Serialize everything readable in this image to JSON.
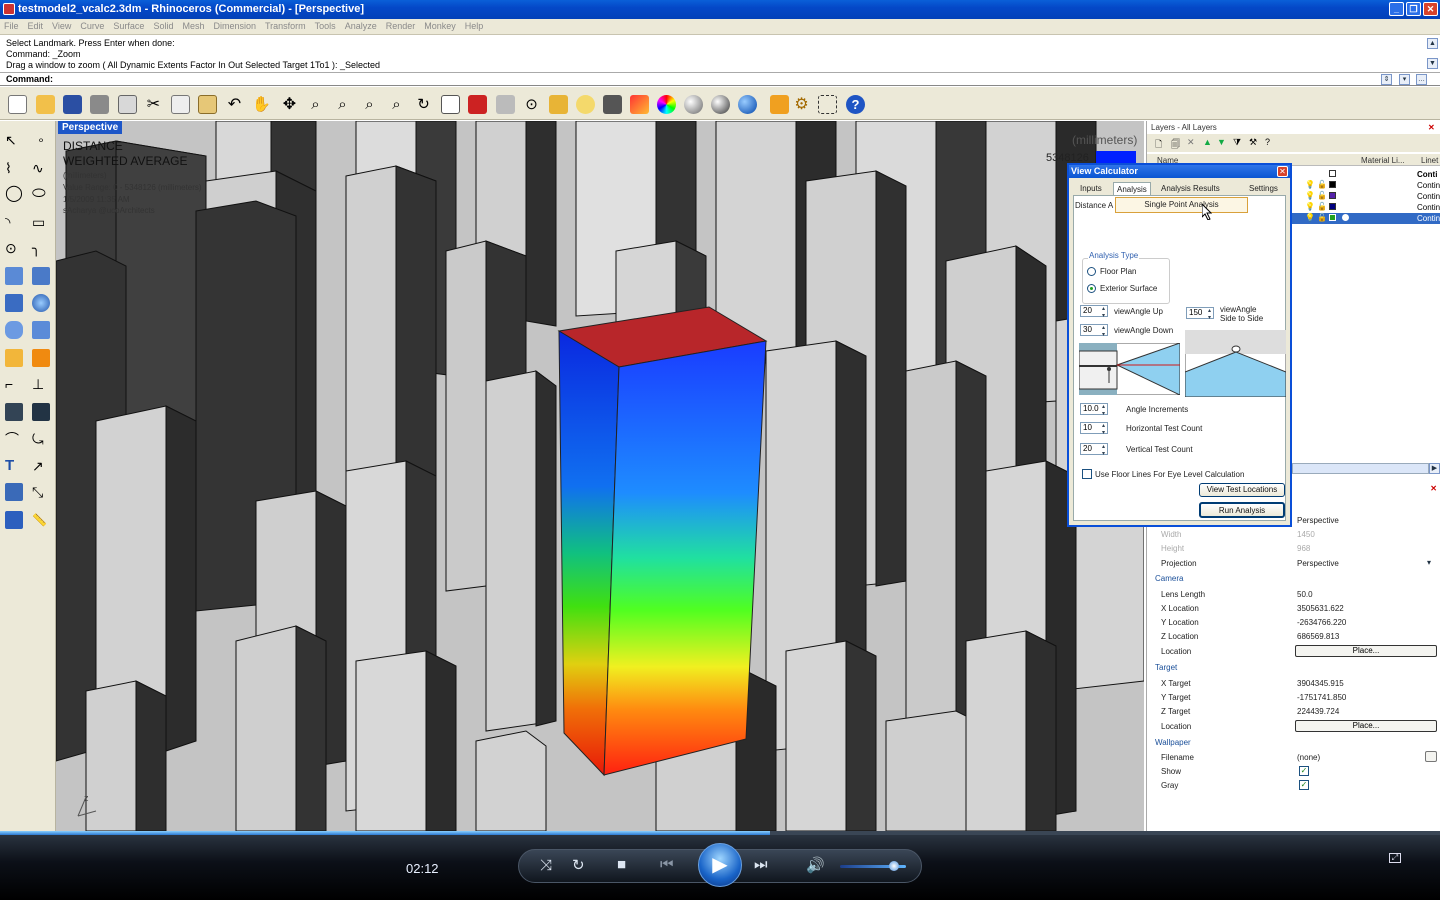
{
  "window": {
    "title": "testmodel2_vcalc2.3dm - Rhinoceros (Commercial) - [Perspective]",
    "minimize": "_",
    "maximize": "❐",
    "close": "✕"
  },
  "menu": [
    "File",
    "Edit",
    "View",
    "Curve",
    "Surface",
    "Solid",
    "Mesh",
    "Dimension",
    "Transform",
    "Tools",
    "Analyze",
    "Render",
    "Monkey",
    "Help"
  ],
  "command": {
    "history": [
      "Select Landmark. Press Enter when done:",
      "Command: _Zoom",
      "Drag a window to zoom ( All  Dynamic  Extents  Factor  In  Out  Selected  Target  1To1 ): _Selected"
    ],
    "prompt": "Command:"
  },
  "viewport": {
    "tab": "Perspective",
    "legend_title_1": "DISTANCE",
    "legend_title_2": "WEIGHTED AVERAGE",
    "legend_units": "(millimeters)",
    "legend_range": "Value Range: 0 - 5348126 (millimeters)",
    "legend_date": "1/5/2009 11:35 AM",
    "legend_user": "sAcharya @ucoArchitects",
    "units_right": "(millimeters)",
    "value_right": "5348126",
    "axis_label": "z"
  },
  "layers": {
    "title": "Layers - All Layers",
    "close": "✕",
    "col_name": "Name",
    "col_material": "Material Li...",
    "col_linetype": "Linet",
    "rows": [
      {
        "linetype": "Conti",
        "color": "#000000"
      },
      {
        "linetype": "Contin",
        "color": "#000000"
      },
      {
        "linetype": "Contin",
        "color": "#5522aa"
      },
      {
        "linetype": "Contin",
        "color": "#000080"
      },
      {
        "linetype": "Contin",
        "color": "#21a121"
      }
    ]
  },
  "view_calculator": {
    "title": "View Calculator",
    "close": "✕",
    "tabs": [
      "Inputs",
      "Analysis",
      "Analysis Results",
      "Settings"
    ],
    "active_tab": "Analysis",
    "subtab": "Distance A",
    "dropdown_item": "Single Point Analysis",
    "analysis_type_label": "Analysis Type",
    "radio_floor_plan": "Floor Plan",
    "radio_exterior": "Exterior Surface",
    "selected_analysis_type": "Exterior Surface",
    "view_angle_up_value": "20",
    "view_angle_up_label": "viewAngle Up",
    "view_angle_down_value": "30",
    "view_angle_down_label": "viewAngle Down",
    "side_value": "150",
    "side_label_1": "viewAngle",
    "side_label_2": "Side to Side",
    "angle_inc_value": "10.0",
    "angle_inc_label": "Angle Increments",
    "horiz_count_value": "10",
    "horiz_count_label": "Horizontal Test Count",
    "vert_count_value": "20",
    "vert_count_label": "Vertical Test Count",
    "floor_lines_label": "Use Floor Lines For Eye Level Calculation",
    "floor_lines_checked": false,
    "btn_view_locations": "View Test Locations",
    "btn_run": "Run Analysis"
  },
  "properties": {
    "title_value": "Perspective",
    "width_label": "Width",
    "width_value": "1450",
    "height_label": "Height",
    "height_value": "968",
    "projection_label": "Projection",
    "projection_value": "Perspective",
    "camera_section": "Camera",
    "lens_label": "Lens Length",
    "lens_value": "50.0",
    "xloc_label": "X Location",
    "xloc_value": "3505631.622",
    "yloc_label": "Y Location",
    "yloc_value": "-2634766.220",
    "zloc_label": "Z Location",
    "zloc_value": "686569.813",
    "cam_location_label": "Location",
    "cam_place_btn": "Place...",
    "target_section": "Target",
    "xt_label": "X Target",
    "xt_value": "3904345.915",
    "yt_label": "Y Target",
    "yt_value": "-1751741.850",
    "zt_label": "Z Target",
    "zt_value": "224439.724",
    "tgt_location_label": "Location",
    "tgt_place_btn": "Place...",
    "wallpaper_section": "Wallpaper",
    "filename_label": "Filename",
    "filename_value": "(none)",
    "show_label": "Show",
    "show_checked": true,
    "gray_label": "Gray",
    "gray_checked": true
  },
  "player": {
    "time": "02:12",
    "progress": 0.535,
    "volume": 0.82
  }
}
